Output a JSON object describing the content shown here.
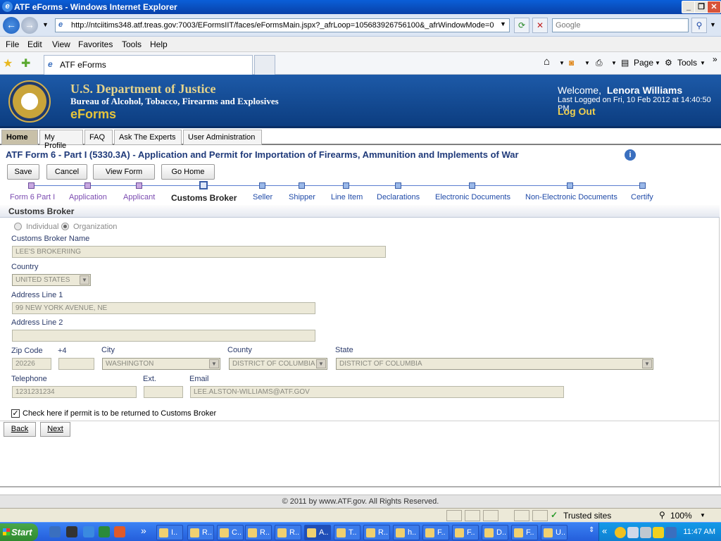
{
  "window": {
    "title": "ATF eForms - Windows Internet Explorer"
  },
  "browser": {
    "url": "http://ntciitims348.atf.treas.gov:7003/EFormsIIT/faces/eFormsMain.jspx?_afrLoop=105683926756100&_afrWindowMode=0",
    "search_placeholder": "Google",
    "menu": [
      "File",
      "Edit",
      "View",
      "Favorites",
      "Tools",
      "Help"
    ],
    "tab_label": "ATF eForms",
    "page_menu": "Page",
    "tools_menu": "Tools"
  },
  "banner": {
    "department": "U.S. Department of Justice",
    "bureau": "Bureau of Alcohol, Tobacco, Firearms and Explosives",
    "app_name": "eForms",
    "welcome_prefix": "Welcome,",
    "user_name": "Lenora Williams",
    "last_logged": "Last Logged on Fri, 10 Feb 2012 at 14:40:50 PM",
    "logout": "Log Out"
  },
  "app_tabs": [
    "Home",
    "My Profile",
    "FAQ",
    "Ask The Experts",
    "User Administration"
  ],
  "form": {
    "title": "ATF Form 6 - Part I (5330.3A) - Application and Permit for Importation of Firearms, Ammunition and Implements of War",
    "actions": [
      "Save",
      "Cancel",
      "View Form",
      "Go Home"
    ],
    "steps": [
      "Form 6 Part I",
      "Application",
      "Applicant",
      "Customs Broker",
      "Seller",
      "Shipper",
      "Line Item",
      "Declarations",
      "Electronic Documents",
      "Non-Electronic Documents",
      "Certify"
    ],
    "current_step_index": 3,
    "section_title": "Customs Broker",
    "radio_individual": "Individual",
    "radio_organization": "Organization",
    "radio_selected": "Organization",
    "labels": {
      "broker_name": "Customs Broker Name",
      "country": "Country",
      "address1": "Address Line 1",
      "address2": "Address Line 2",
      "zip": "Zip Code",
      "plus4": "+4",
      "city": "City",
      "county": "County",
      "state": "State",
      "telephone": "Telephone",
      "ext": "Ext.",
      "email": "Email"
    },
    "values": {
      "broker_name": "LEE'S BROKERIING",
      "country": "UNITED STATES",
      "address1": "99 NEW YORK AVENUE, NE",
      "address2": "",
      "zip": "20226",
      "plus4": "",
      "city": "WASHINGTON",
      "county": "DISTRICT OF COLUMBIA",
      "state": "DISTRICT OF COLUMBIA",
      "telephone": "1231231234",
      "ext": "",
      "email": "LEE.ALSTON-WILLIAMS@ATF.GOV"
    },
    "return_checkbox_label": "Check here if permit is to be returned to Customs Broker",
    "return_checked": true,
    "back": "Back",
    "next": "Next"
  },
  "footer": "© 2011 by www.ATF.gov. All Rights Reserved.",
  "statusbar": {
    "zone": "Trusted sites",
    "zoom": "100%"
  },
  "taskbar": {
    "start": "Start",
    "items": [
      "I..",
      "R..",
      "C..",
      "R..",
      "R..",
      "A..",
      "T..",
      "R..",
      "h..",
      "F..",
      "F..",
      "D..",
      "F..",
      "U.."
    ],
    "clock": "11:47 AM"
  }
}
